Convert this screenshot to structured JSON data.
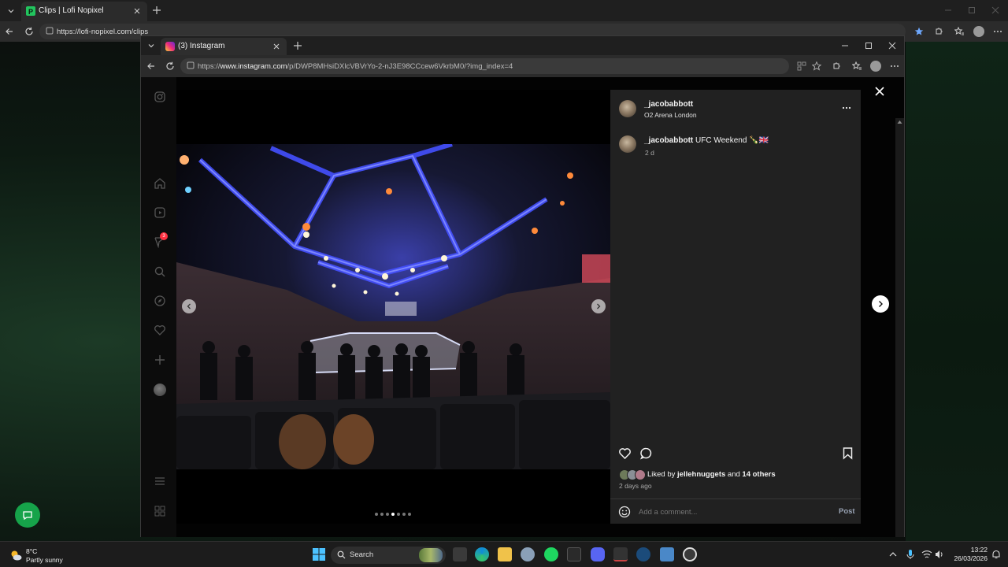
{
  "outer_browser": {
    "tab_title": "Clips | Lofi Nopixel",
    "url": "https://lofi-nopixel.com/clips"
  },
  "inner_browser": {
    "tab_title": "(3) Instagram",
    "url_prefix": "https://",
    "url_domain": "www.instagram.com",
    "url_path": "/p/DWP8MHsiDXlcVBVrYo-2-nJ3E98CCcew6VkrbM0/?img_index=4"
  },
  "sidebar": {
    "notification_count": "3",
    "icons": [
      "instagram-logo-icon",
      "home-icon",
      "reels-icon",
      "messages-icon",
      "search-icon",
      "explore-icon",
      "heart-icon",
      "create-icon",
      "profile-avatar",
      "menu-icon",
      "more-apps-icon"
    ]
  },
  "post": {
    "username": "_jacobabbott",
    "location": "O2 Arena London",
    "caption_user": "_jacobabbott",
    "caption_text": "UFC Weekend 🍾🇬🇧",
    "caption_time": "2 d",
    "liked_by_prefix": "Liked by ",
    "liked_by_user": "jellehnuggets",
    "liked_by_middle": " and ",
    "liked_by_others": "14 others",
    "posted_ago": "2 days ago",
    "comment_placeholder": "Add a comment...",
    "post_button": "Post",
    "carousel": {
      "total": 7,
      "active": 4
    }
  },
  "taskbar": {
    "weather_temp": "8°C",
    "weather_desc": "Partly sunny",
    "search_label": "Search",
    "time": "13:22",
    "date": "26/03/2026"
  },
  "colors": {
    "accent_green": "#16a34a",
    "ig_panel": "#212121",
    "arena_blue": "#3a4bff"
  }
}
